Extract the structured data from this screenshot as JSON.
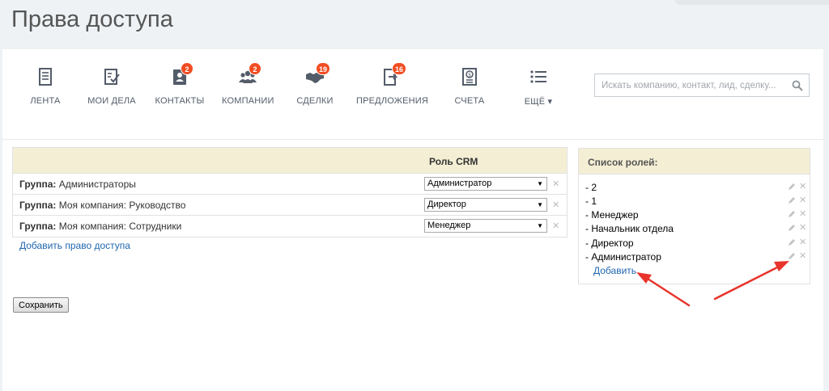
{
  "page": {
    "title": "Права доступа"
  },
  "toolbar": {
    "items": [
      {
        "label": "ЛЕНТА",
        "icon": "feed-icon",
        "badge": ""
      },
      {
        "label": "МОИ ДЕЛА",
        "icon": "tasks-icon",
        "badge": ""
      },
      {
        "label": "КОНТАКТЫ",
        "icon": "contacts-icon",
        "badge": "2"
      },
      {
        "label": "КОМПАНИИ",
        "icon": "companies-icon",
        "badge": "2"
      },
      {
        "label": "СДЕЛКИ",
        "icon": "deals-icon",
        "badge": "19"
      },
      {
        "label": "ПРЕДЛОЖЕНИЯ",
        "icon": "quotes-icon",
        "badge": "16"
      },
      {
        "label": "СЧЕТА",
        "icon": "invoices-icon",
        "badge": ""
      },
      {
        "label": "ЕЩЁ ▾",
        "icon": "more-list-icon",
        "badge": ""
      }
    ],
    "search_placeholder": "Искать компанию, контакт, лид, сделку..."
  },
  "rights": {
    "role_column": "Роль CRM",
    "rows": [
      {
        "prefix": "Группа:",
        "name": "Администраторы",
        "role": "Администратор"
      },
      {
        "prefix": "Группа:",
        "name": "Моя компания: Руководство",
        "role": "Директор"
      },
      {
        "prefix": "Группа:",
        "name": "Моя компания: Сотрудники",
        "role": "Менеджер"
      }
    ],
    "add_link": "Добавить право доступа"
  },
  "roles": {
    "title": "Список ролей:",
    "items": [
      "- 2",
      "- 1",
      "- Менеджер",
      "- Начальник отдела",
      "- Директор",
      "- Администратор"
    ],
    "add_link": "Добавить"
  },
  "save_button": "Сохранить",
  "colors": {
    "badge": "#f24d22",
    "link": "#2067b0",
    "header_bg": "#f4efd4",
    "annotation_arrow": "#e8342c"
  }
}
